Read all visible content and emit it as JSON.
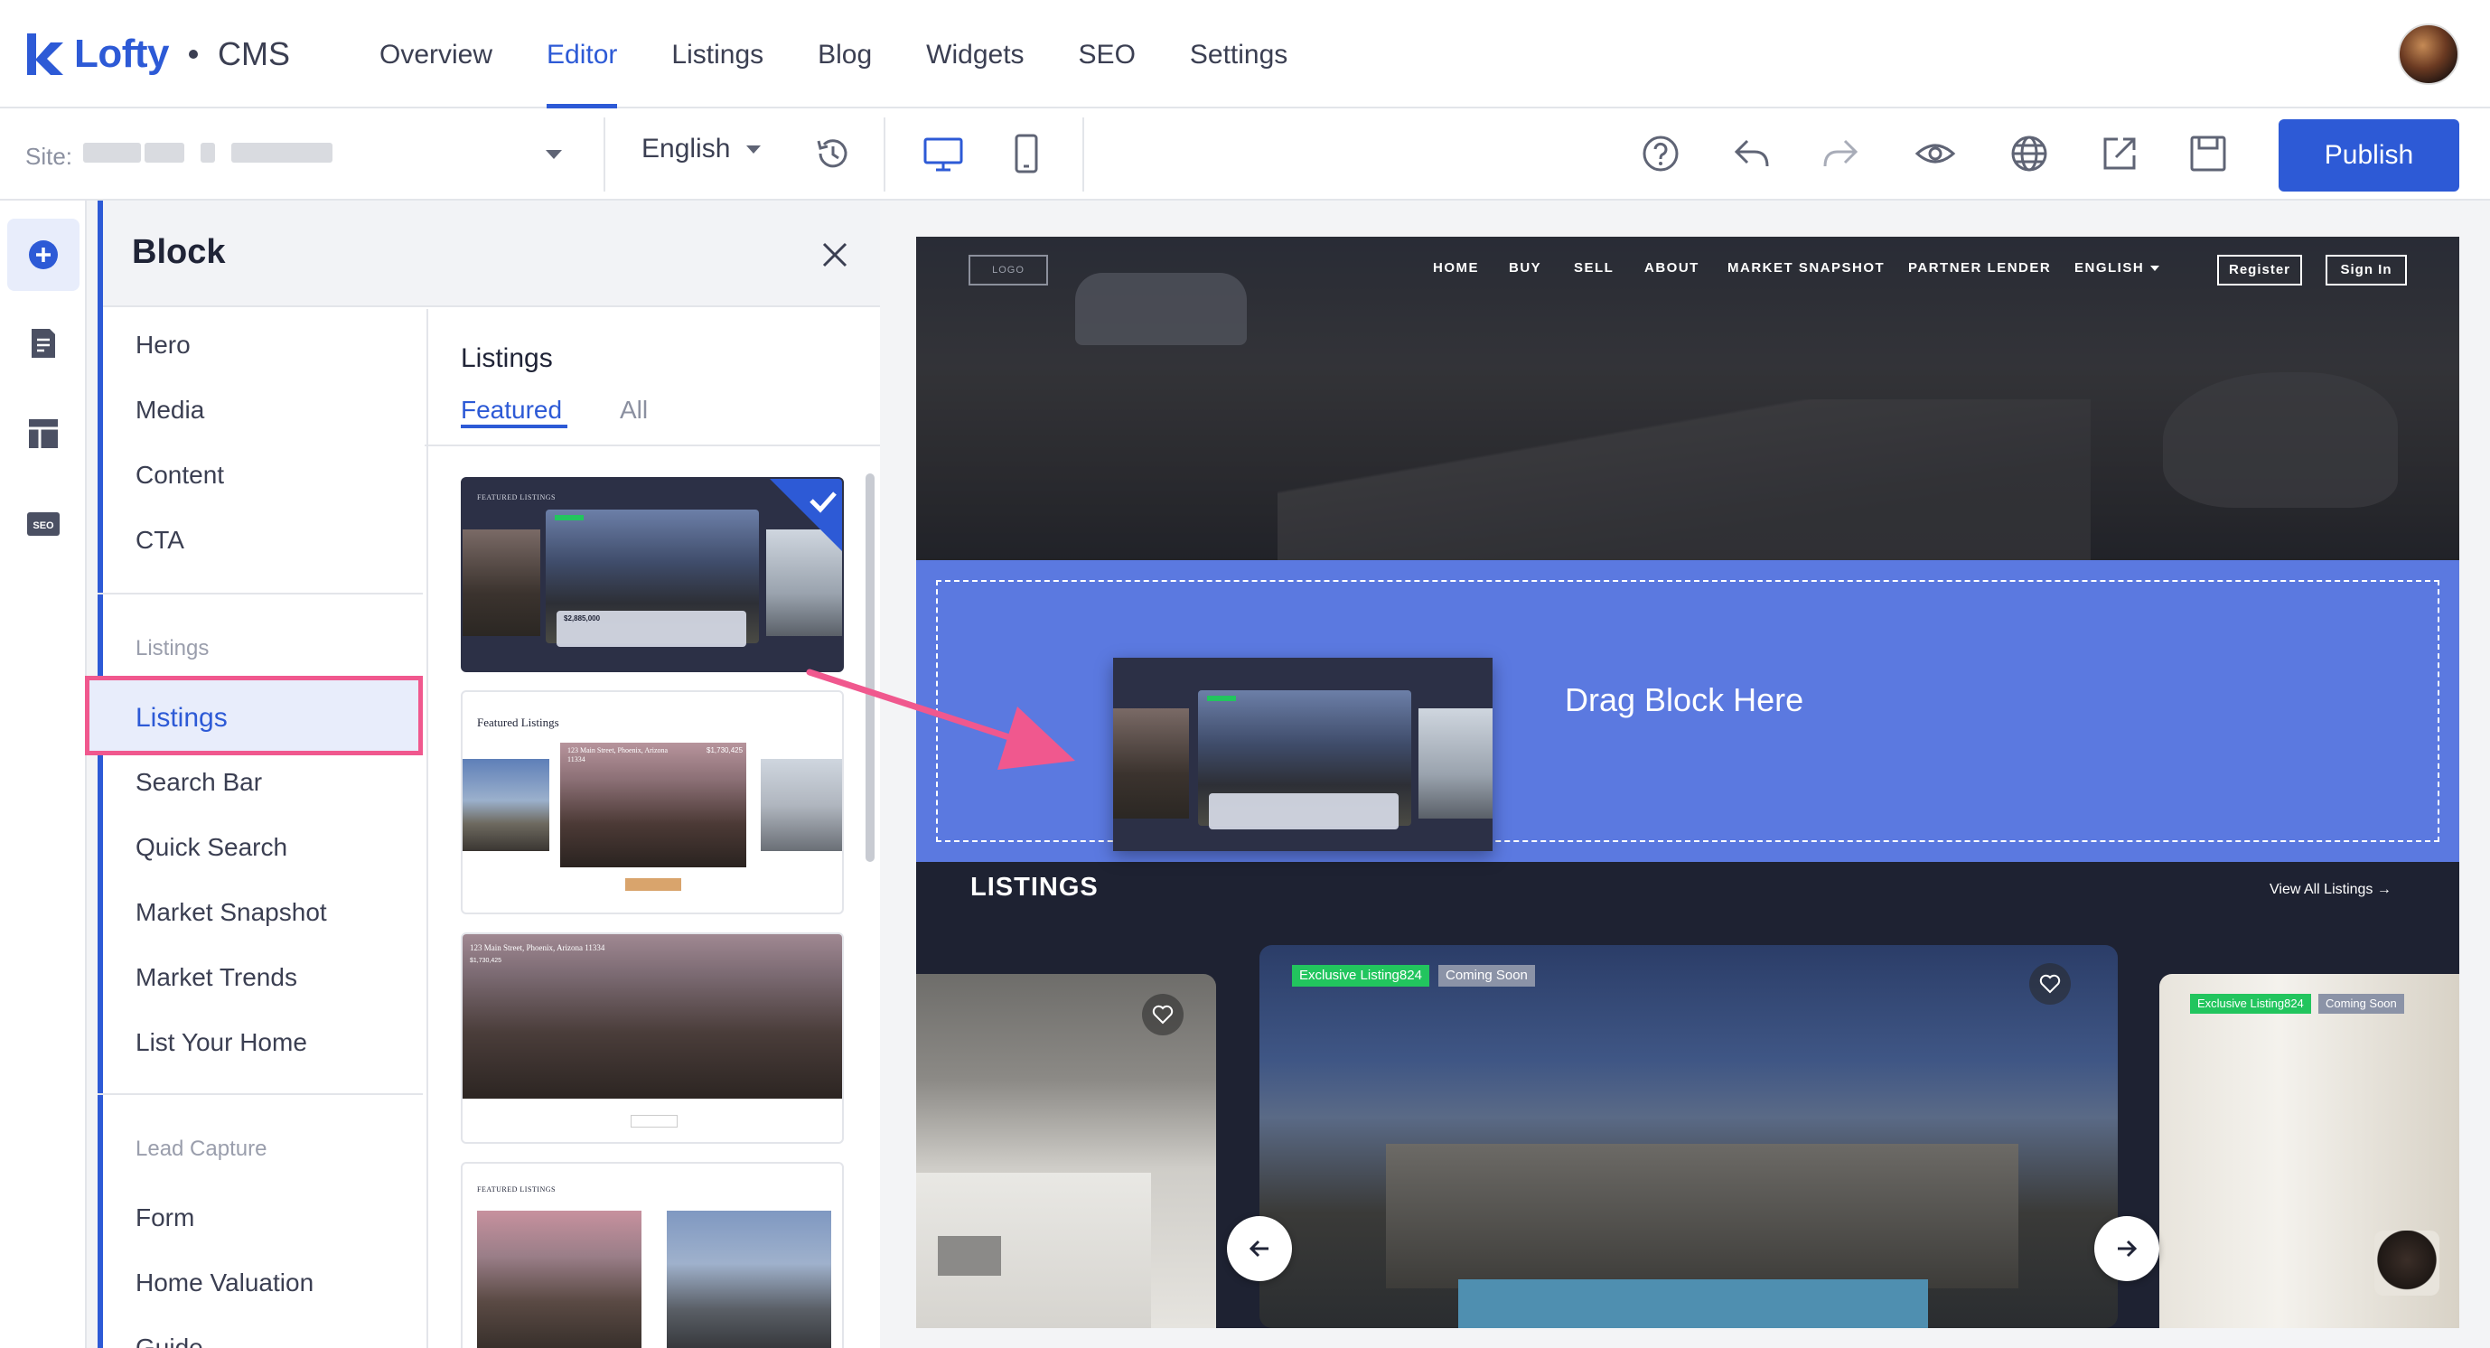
{
  "brand": {
    "name": "Lofty",
    "product": "CMS"
  },
  "nav": {
    "items": [
      "Overview",
      "Editor",
      "Listings",
      "Blog",
      "Widgets",
      "SEO",
      "Settings"
    ],
    "active": "Editor"
  },
  "toolbar": {
    "site_label": "Site:",
    "language": "English",
    "publish_label": "Publish"
  },
  "panel": {
    "title": "Block",
    "categories_top": [
      "Hero",
      "Media",
      "Content",
      "CTA"
    ],
    "section_listings": "Listings",
    "categories_listings": [
      "Listings",
      "Search Bar",
      "Quick Search",
      "Market Snapshot",
      "Market Trends",
      "List Your Home"
    ],
    "section_lead": "Lead Capture",
    "categories_lead": [
      "Form",
      "Home Valuation",
      "Guide"
    ],
    "gallery_title": "Listings",
    "tabs": [
      "Featured",
      "All"
    ],
    "thumbs": {
      "t1_heading": "FEATURED LISTINGS",
      "t1_price": "$2,885,000",
      "t2_heading": "Featured Listings",
      "t2_address": "123 Main Street, Phoenix, Arizona 11334",
      "t2_price": "$1,730,425",
      "t3_address": "123 Main Street, Phoenix, Arizona 11334",
      "t3_price": "$1,730,425",
      "t4_heading": "FEATURED LISTINGS"
    }
  },
  "preview": {
    "logo": "LOGO",
    "site_nav": [
      "HOME",
      "BUY",
      "SELL",
      "ABOUT",
      "MARKET SNAPSHOT",
      "PARTNER LENDER",
      "ENGLISH"
    ],
    "register": "Register",
    "sign_in": "Sign In",
    "drop_text": "Drag Block Here",
    "listings_title": "LISTINGS",
    "view_all": "View All Listings",
    "badge_exclusive": "Exclusive Listing824",
    "badge_coming": "Coming Soon"
  },
  "colors": {
    "accent": "#2d5ad6",
    "highlight": "#f0588e",
    "drop_zone": "#5b79e0",
    "badge_green": "#22c55e"
  }
}
